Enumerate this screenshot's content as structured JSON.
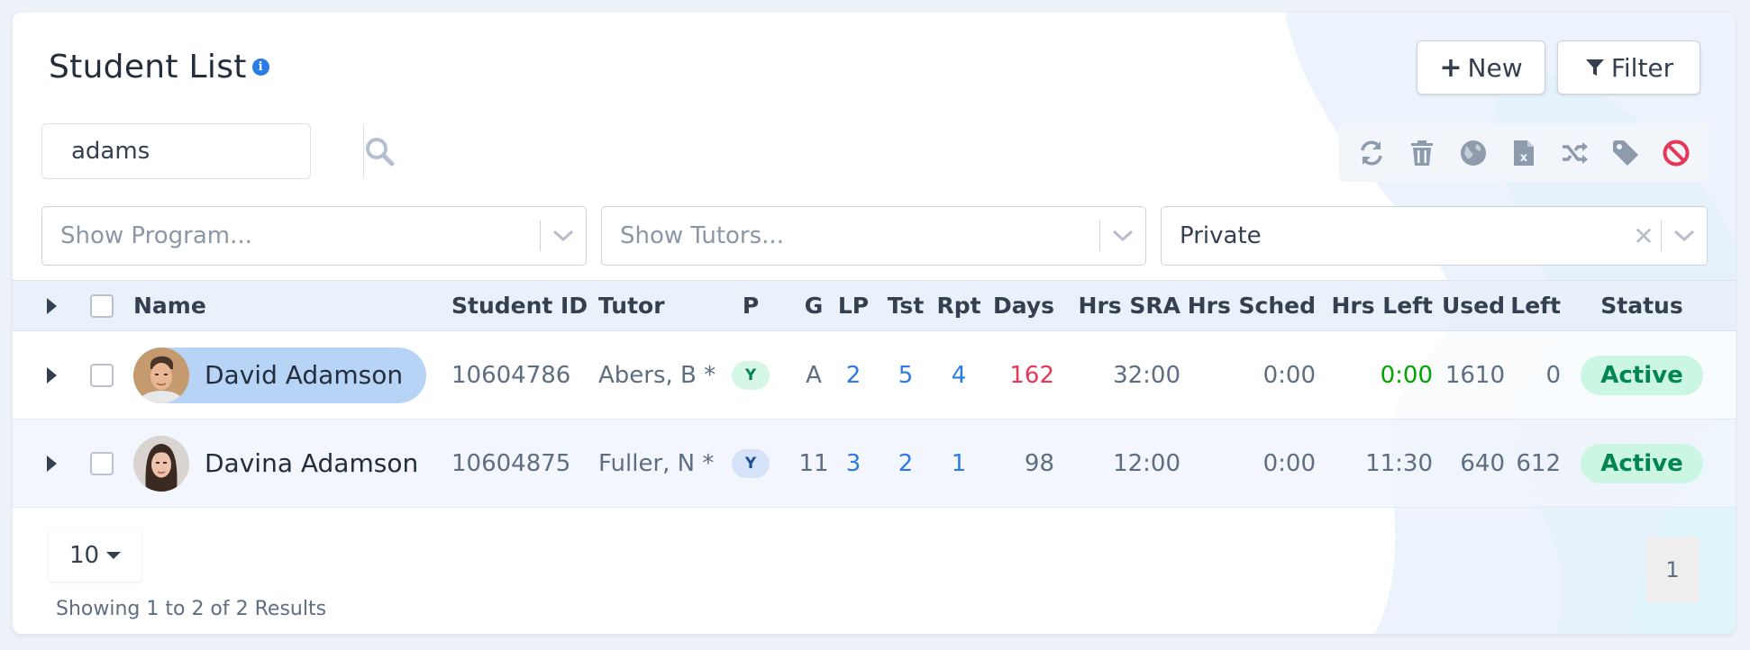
{
  "header": {
    "title": "Student List",
    "info_icon": "info-icon"
  },
  "buttons": {
    "new_label": "New",
    "filter_label": "Filter"
  },
  "search": {
    "value": "adams"
  },
  "toolbar": {
    "icons": [
      "refresh-icon",
      "trash-icon",
      "globe-icon",
      "excel-icon",
      "shuffle-icon",
      "tag-icon",
      "ban-icon"
    ],
    "ban_color": "#e63757"
  },
  "filters": {
    "program_placeholder": "Show Program...",
    "tutors_placeholder": "Show Tutors...",
    "type_value": "Private"
  },
  "table": {
    "columns": {
      "name": "Name",
      "student_id": "Student ID",
      "tutor": "Tutor",
      "p": "P",
      "g": "G",
      "lp": "LP",
      "tst": "Tst",
      "rpt": "Rpt",
      "days": "Days",
      "hrs_sra": "Hrs SRA",
      "hrs_sched": "Hrs Sched",
      "hrs_left": "Hrs Left",
      "used": "Used",
      "left": "Left",
      "status": "Status"
    },
    "rows": [
      {
        "name": "David Adamson",
        "student_id": "10604786",
        "tutor": "Abers, B *",
        "p": "Y",
        "g": "A",
        "lp": "2",
        "tst": "5",
        "rpt": "4",
        "days": "162",
        "hrs_sra": "32:00",
        "hrs_sched": "0:00",
        "hrs_left": "0:00",
        "used": "1610",
        "left": "0",
        "status": "Active"
      },
      {
        "name": "Davina Adamson",
        "student_id": "10604875",
        "tutor": "Fuller, N *",
        "p": "Y",
        "g": "11",
        "lp": "3",
        "tst": "2",
        "rpt": "1",
        "days": "98",
        "hrs_sra": "12:00",
        "hrs_sched": "0:00",
        "hrs_left": "11:30",
        "used": "640",
        "left": "612",
        "status": "Active"
      }
    ]
  },
  "colors": {
    "link": "#2c7be5",
    "days_alert": "#e63757",
    "hrs_left_ok": "#00a400",
    "status_bg": "#ccf6e4",
    "status_text": "#00864e"
  },
  "pagination": {
    "per_page": "10",
    "showing": "Showing 1 to 2 of 2 Results",
    "current_page": "1"
  }
}
